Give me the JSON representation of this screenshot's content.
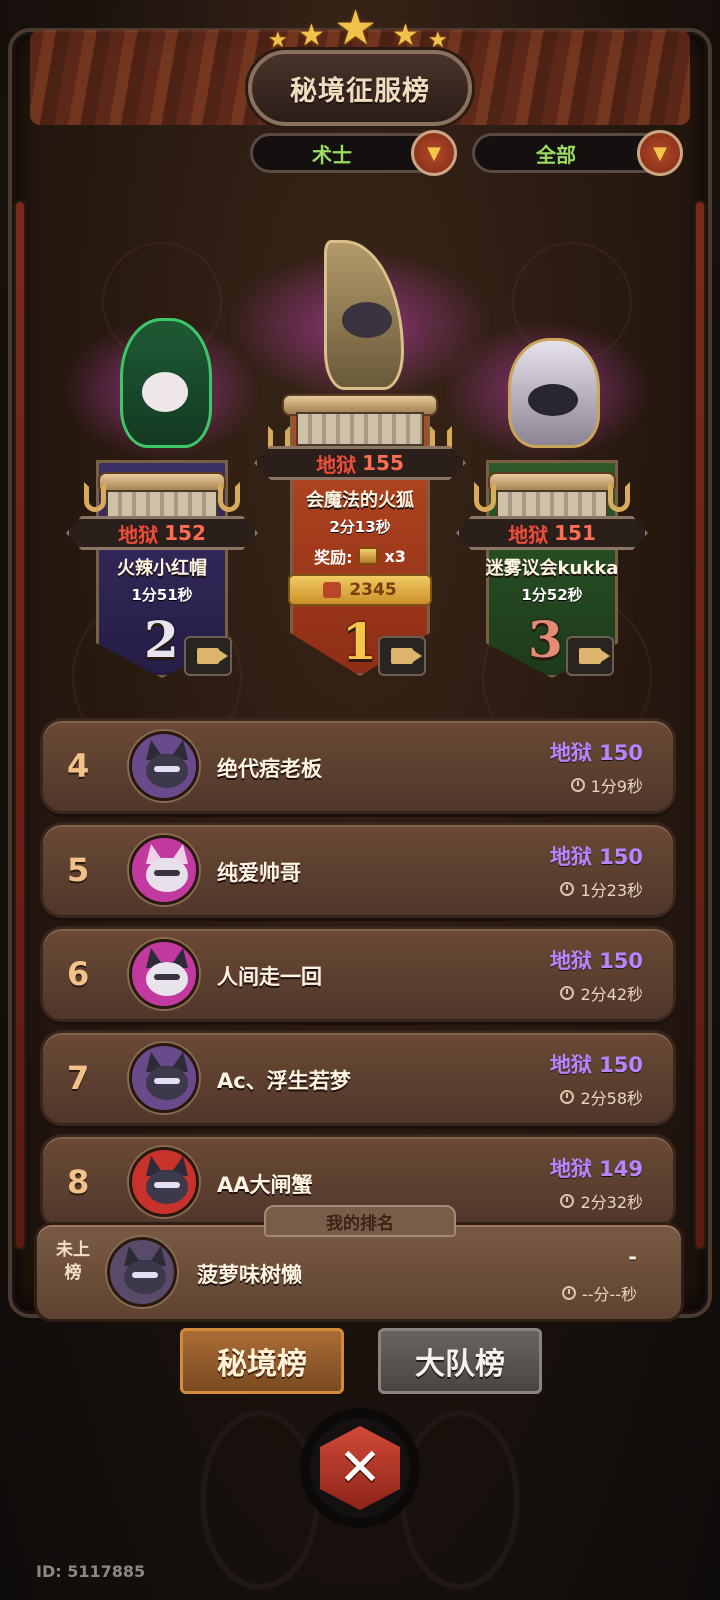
{
  "title": "秘境征服榜",
  "filters": {
    "class_value": "术士",
    "scope_value": "全部"
  },
  "podium": [
    {
      "rank": "1",
      "level_label": "地狱",
      "level": "155",
      "name": "会魔法的火狐",
      "time": "2分13秒",
      "reward_label": "奖励:",
      "reward_count": "x3",
      "likes": "2345"
    },
    {
      "rank": "2",
      "level_label": "地狱",
      "level": "152",
      "name": "火辣小红帽",
      "time": "1分51秒"
    },
    {
      "rank": "3",
      "level_label": "地狱",
      "level": "151",
      "name": "迷雾议会kukka",
      "time": "1分52秒"
    }
  ],
  "rows": [
    {
      "rank": "4",
      "name": "绝代痞老板",
      "level": "地狱 150",
      "time": "1分9秒"
    },
    {
      "rank": "5",
      "name": "纯爱帅哥",
      "level": "地狱 150",
      "time": "1分23秒"
    },
    {
      "rank": "6",
      "name": "人间走一回",
      "level": "地狱 150",
      "time": "2分42秒"
    },
    {
      "rank": "7",
      "name": "Ac、浮生若梦",
      "level": "地狱 150",
      "time": "2分58秒"
    },
    {
      "rank": "8",
      "name": "AA大闸蟹",
      "level": "地狱 149",
      "time": "2分32秒"
    }
  ],
  "my_rank": {
    "tab_label": "我的排名",
    "rank_text": "未上榜",
    "name": "菠萝味树懒",
    "level": "-",
    "time": "--分--秒"
  },
  "tabs": {
    "active": "秘境榜",
    "inactive": "大队榜"
  },
  "close_icon": "✕",
  "user_id": "ID: 5117885",
  "icons": [
    "star-icon",
    "dropdown-arrow-icon",
    "video-icon",
    "chest-icon",
    "thumbs-up-icon",
    "clock-icon",
    "close-icon"
  ],
  "colors": {
    "level_purple": "#b586ff",
    "level_red": "#ee4d3b",
    "filter_green": "#9bdc63",
    "gold": "#f1c24a"
  }
}
